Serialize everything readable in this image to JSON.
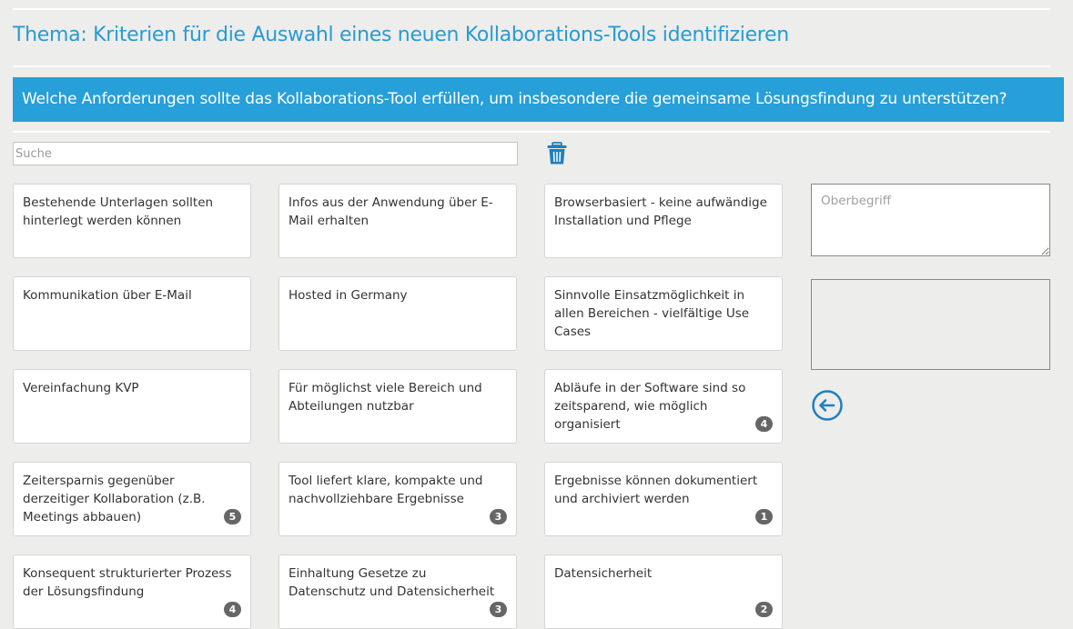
{
  "topic": "Thema: Kriterien für die Auswahl eines neuen Kollaborations-Tools identifizieren",
  "question": "Welche Anforderungen sollte das Kollaborations-Tool erfüllen, um insbesondere die gemeinsame Lösungsfindung zu unterstützen?",
  "search": {
    "placeholder": "Suche",
    "value": ""
  },
  "colors": {
    "accent": "#279fd8",
    "badge": "#666666",
    "icon": "#1e7fc0"
  },
  "icons": {
    "delete": "trash-icon",
    "back": "arrow-left-circle-icon"
  },
  "cards": [
    {
      "text": "Bestehende Unterlagen sollten hinterlegt werden können",
      "badge": ""
    },
    {
      "text": "Infos aus der Anwendung über E-Mail erhalten",
      "badge": ""
    },
    {
      "text": "Browserbasiert - keine aufwändige Installation und Pflege",
      "badge": ""
    },
    {
      "text": "Kommunikation über E-Mail",
      "badge": ""
    },
    {
      "text": "Hosted in Germany",
      "badge": ""
    },
    {
      "text": "Sinnvolle Einsatzmöglichkeit in allen Bereichen - vielfältige Use Cases",
      "badge": ""
    },
    {
      "text": "Vereinfachung KVP",
      "badge": ""
    },
    {
      "text": "Für möglichst viele Bereich und Abteilungen nutzbar",
      "badge": ""
    },
    {
      "text": "Abläufe in der Software sind so zeitsparend, wie möglich organisiert",
      "badge": "4"
    },
    {
      "text": "Zeitersparnis gegenüber derzeitiger Kollaboration (z.B. Meetings abbauen)",
      "badge": "5"
    },
    {
      "text": "Tool liefert klare, kompakte und nachvollziehbare Ergebnisse",
      "badge": "3"
    },
    {
      "text": "Ergebnisse können dokumentiert und archiviert werden",
      "badge": "1"
    },
    {
      "text": "Konsequent strukturierter Prozess der Lösungsfindung",
      "badge": "4"
    },
    {
      "text": "Einhaltung Gesetze zu Datenschutz und Datensicherheit",
      "badge": "3"
    },
    {
      "text": "Datensicherheit",
      "badge": "2"
    }
  ],
  "oberbegriff": {
    "placeholder": "Oberbegriff",
    "value": ""
  }
}
